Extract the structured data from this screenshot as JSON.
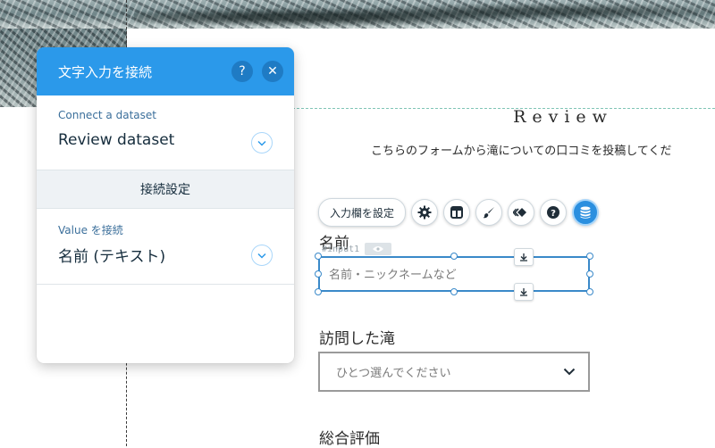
{
  "panel": {
    "title": "文字入力を接続",
    "help_label": "?",
    "close_label": "✕",
    "dataset_label": "Connect a dataset",
    "dataset_value": "Review dataset",
    "settings_label": "接続設定",
    "value_label": "Value を接続",
    "value_selected": "名前 (テキスト)"
  },
  "page": {
    "review_title": "Review",
    "intro": "こちらのフォームから滝についての口コミを投稿してくだ",
    "name_label": "名前",
    "component_id": "#input1",
    "name_placeholder": "名前・ニックネームなど",
    "waterfall_label": "訪問した滝",
    "waterfall_value": "ひとつ選んでください",
    "rating_label": "総合評価"
  },
  "toolbar": {
    "set_input_label": "入力欄を設定",
    "icons": [
      "gear-icon",
      "layout-icon",
      "brush-icon",
      "animation-icon",
      "help-icon",
      "database-icon"
    ]
  },
  "colors": {
    "accent": "#2b99ea",
    "selection": "#3a89c9",
    "guide": "#7fc4b6"
  }
}
